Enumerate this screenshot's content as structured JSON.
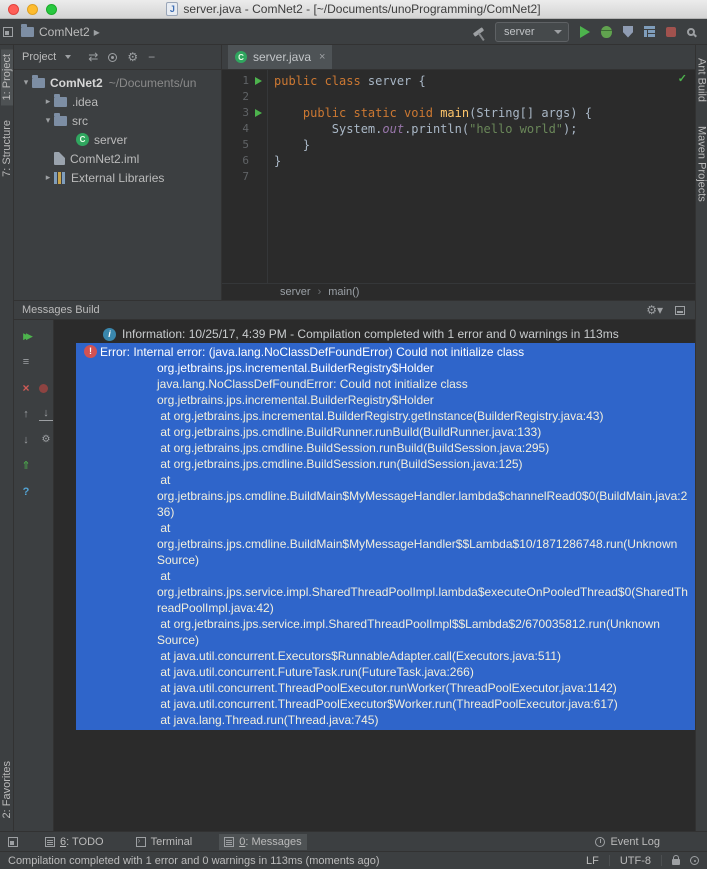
{
  "titlebar": {
    "title": "server.java - ComNet2 - [~/Documents/unoProgramming/ComNet2]"
  },
  "toolbar": {
    "nav_project": "ComNet2",
    "run_config": "server"
  },
  "stripes": {
    "left_top": [
      {
        "id": "project",
        "label": "1: Project",
        "active": true
      },
      {
        "id": "structure",
        "label": "7: Structure",
        "active": false
      }
    ],
    "left_bottom": [
      {
        "id": "favorites",
        "label": "2: Favorites",
        "active": false
      }
    ],
    "right": [
      {
        "id": "ant-build",
        "label": "Ant Build"
      },
      {
        "id": "maven-projects",
        "label": "Maven Projects"
      }
    ]
  },
  "project": {
    "header": "Project",
    "tree": [
      {
        "id": "root",
        "label": "ComNet2",
        "detail": "~/Documents/un",
        "level": 0,
        "icon": "folder",
        "arrow": "down",
        "bold": true
      },
      {
        "id": "idea",
        "label": ".idea",
        "level": 1,
        "icon": "folder",
        "arrow": "right"
      },
      {
        "id": "src",
        "label": "src",
        "level": 1,
        "icon": "folder",
        "arrow": "down"
      },
      {
        "id": "server",
        "label": "server",
        "level": 2,
        "icon": "class"
      },
      {
        "id": "iml",
        "label": "ComNet2.iml",
        "level": 1,
        "icon": "file"
      },
      {
        "id": "external-libraries",
        "label": "External Libraries",
        "level": 1,
        "icon": "lib",
        "arrow": "right"
      }
    ]
  },
  "editor": {
    "tab": "server.java",
    "breadcrumbs": [
      "server",
      "main()"
    ],
    "code": [
      {
        "n": 1,
        "run": true,
        "tokens": [
          {
            "t": "public class",
            "c": "kw"
          },
          {
            "t": " server {",
            "c": "pl"
          }
        ]
      },
      {
        "n": 2,
        "tokens": []
      },
      {
        "n": 3,
        "run": true,
        "tokens": [
          {
            "t": "    ",
            "c": "pl"
          },
          {
            "t": "public static void",
            "c": "kw"
          },
          {
            "t": " ",
            "c": "pl"
          },
          {
            "t": "main",
            "c": "fn"
          },
          {
            "t": "(String[] args) {",
            "c": "pl"
          }
        ]
      },
      {
        "n": 4,
        "tokens": [
          {
            "t": "        System.",
            "c": "pl"
          },
          {
            "t": "out",
            "c": "field"
          },
          {
            "t": ".println(",
            "c": "pl"
          },
          {
            "t": "\"hello world\"",
            "c": "str"
          },
          {
            "t": ");",
            "c": "pl"
          }
        ]
      },
      {
        "n": 5,
        "tokens": [
          {
            "t": "    }",
            "c": "pl"
          }
        ]
      },
      {
        "n": 6,
        "tokens": [
          {
            "t": "}",
            "c": "pl"
          }
        ]
      },
      {
        "n": 7,
        "tokens": []
      }
    ]
  },
  "build": {
    "title": "Messages Build",
    "info": "Information: 10/25/17, 4:39 PM - Compilation completed with 1 error and 0 warnings in 113ms",
    "error_title": "Error: Internal error: (java.lang.NoClassDefFoundError) Could not initialize class org.jetbrains.jps.incremental.BuilderRegistry$Holder",
    "stack": [
      "java.lang.NoClassDefFoundError: Could not initialize class org.jetbrains.jps.incremental.BuilderRegistry$Holder",
      " at org.jetbrains.jps.incremental.BuilderRegistry.getInstance(BuilderRegistry.java:43)",
      " at org.jetbrains.jps.cmdline.BuildRunner.runBuild(BuildRunner.java:133)",
      " at org.jetbrains.jps.cmdline.BuildSession.runBuild(BuildSession.java:295)",
      " at org.jetbrains.jps.cmdline.BuildSession.run(BuildSession.java:125)",
      " at org.jetbrains.jps.cmdline.BuildMain$MyMessageHandler.lambda$channelRead0$0(BuildMain.java:236)",
      " at org.jetbrains.jps.cmdline.BuildMain$MyMessageHandler$$Lambda$10/1871286748.run(Unknown Source)",
      " at org.jetbrains.jps.service.impl.SharedThreadPoolImpl.lambda$executeOnPooledThread$0(SharedThreadPoolImpl.java:42)",
      " at org.jetbrains.jps.service.impl.SharedThreadPoolImpl$$Lambda$2/670035812.run(Unknown Source)",
      " at java.util.concurrent.Executors$RunnableAdapter.call(Executors.java:511)",
      " at java.util.concurrent.FutureTask.run(FutureTask.java:266)",
      " at java.util.concurrent.ThreadPoolExecutor.runWorker(ThreadPoolExecutor.java:1142)",
      " at java.util.concurrent.ThreadPoolExecutor$Worker.run(ThreadPoolExecutor.java:617)",
      " at java.lang.Thread.run(Thread.java:745)"
    ]
  },
  "bottom_bar": {
    "todo_mnemonic": "6",
    "todo_rest": ": TODO",
    "terminal": "Terminal",
    "messages_mnemonic": "0",
    "messages_rest": ": Messages",
    "event_log": "Event Log"
  },
  "status_bar": {
    "message": "Compilation completed with 1 error and 0 warnings in 113ms (moments ago)",
    "line_sep": "LF",
    "encoding": "UTF-8"
  },
  "colors": {
    "selection_blue": "#2f65ca",
    "keyword_orange": "#cc7832",
    "string_green": "#6a8759",
    "method_yellow": "#ffc66b",
    "field_purple": "#9876aa",
    "run_green": "#4db34d",
    "error_red": "#d25252",
    "info_blue": "#3a87ad",
    "panel_bg": "#3c3f41",
    "editor_bg": "#2b2b2b"
  }
}
